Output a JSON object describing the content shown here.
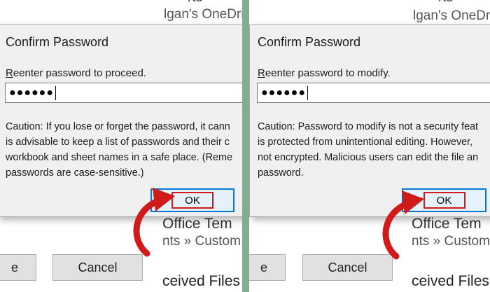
{
  "left": {
    "bg": {
      "top_fragment": "rts",
      "top_line": "lgan's OneDrive",
      "office_text": "Office Tem",
      "breadcrumb": "nts » Custom C",
      "files": "ceived Files",
      "partial_button": "e",
      "cancel": "Cancel"
    },
    "dialog": {
      "title": "Confirm Password",
      "prompt_first": "R",
      "prompt_rest": "eenter password to proceed.",
      "password_mask": "●●●●●●",
      "caution_lines": [
        "Caution: If you lose or forget the password, it cann",
        "is advisable to keep a list of passwords and their c",
        "workbook and sheet names in a safe place.  (Reme",
        "passwords are case-sensitive.)"
      ],
      "ok": "OK"
    }
  },
  "right": {
    "bg": {
      "top_fragment": "rts",
      "top_line": "lgan's OneDrive",
      "office_text": "Office Tem",
      "breadcrumb": "nts » Custom C",
      "files": "ceived Files",
      "partial_button": "e",
      "cancel": "Cancel"
    },
    "dialog": {
      "title": "Confirm Password",
      "prompt_first": "R",
      "prompt_rest": "eenter password to modify.",
      "password_mask": "●●●●●●",
      "caution_lines": [
        "Caution: Password to modify is not a security feat",
        "is protected from unintentional editing. However,",
        "not encrypted. Malicious users can edit the file an",
        "password."
      ],
      "ok": "OK"
    }
  },
  "colors": {
    "divider": "#7fae93",
    "arrow": "#d11a1a",
    "ok_highlight": "#d11a1a",
    "button_focus": "#0078d7"
  }
}
